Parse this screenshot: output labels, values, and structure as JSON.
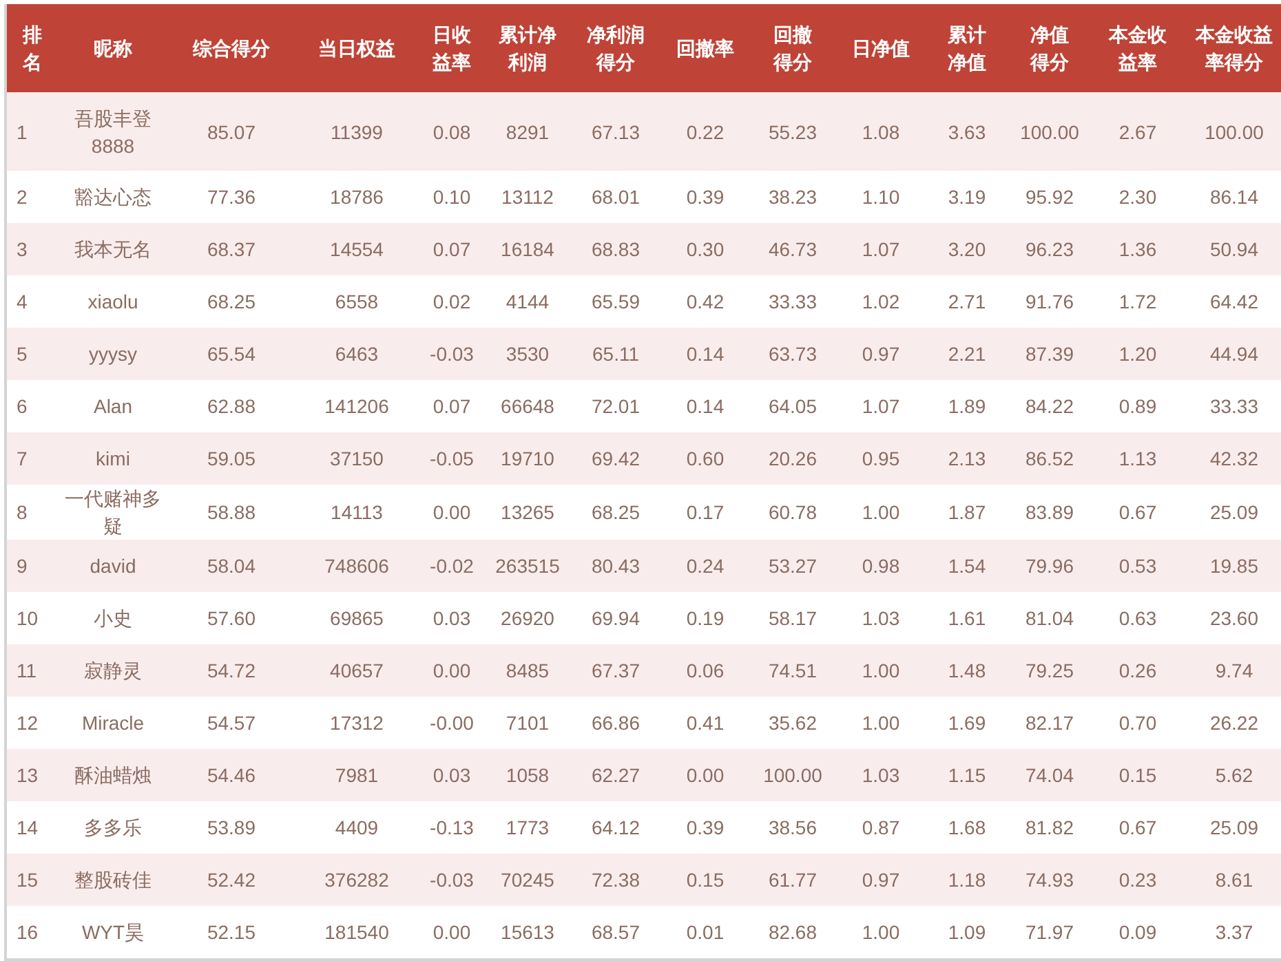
{
  "table": {
    "columns": [
      {
        "lines": [
          "排",
          "名"
        ]
      },
      {
        "lines": [
          "昵称"
        ]
      },
      {
        "lines": [
          "综合得分"
        ]
      },
      {
        "lines": [
          "当日权益"
        ]
      },
      {
        "lines": [
          "日收",
          "益率"
        ]
      },
      {
        "lines": [
          "累计净",
          "利润"
        ]
      },
      {
        "lines": [
          "净利润",
          "得分"
        ]
      },
      {
        "lines": [
          "回撤率"
        ]
      },
      {
        "lines": [
          "回撤",
          "得分"
        ]
      },
      {
        "lines": [
          "日净值"
        ]
      },
      {
        "lines": [
          "累计",
          "净值"
        ]
      },
      {
        "lines": [
          "净值",
          "得分"
        ]
      },
      {
        "lines": [
          "本金收",
          "益率"
        ]
      },
      {
        "lines": [
          "本金收益",
          "率得分"
        ]
      }
    ],
    "rows": [
      [
        "1",
        "吾股丰登8888",
        "85.07",
        "11399",
        "0.08",
        "8291",
        "67.13",
        "0.22",
        "55.23",
        "1.08",
        "3.63",
        "100.00",
        "2.67",
        "100.00"
      ],
      [
        "2",
        "豁达心态",
        "77.36",
        "18786",
        "0.10",
        "13112",
        "68.01",
        "0.39",
        "38.23",
        "1.10",
        "3.19",
        "95.92",
        "2.30",
        "86.14"
      ],
      [
        "3",
        "我本无名",
        "68.37",
        "14554",
        "0.07",
        "16184",
        "68.83",
        "0.30",
        "46.73",
        "1.07",
        "3.20",
        "96.23",
        "1.36",
        "50.94"
      ],
      [
        "4",
        "xiaolu",
        "68.25",
        "6558",
        "0.02",
        "4144",
        "65.59",
        "0.42",
        "33.33",
        "1.02",
        "2.71",
        "91.76",
        "1.72",
        "64.42"
      ],
      [
        "5",
        "yyysy",
        "65.54",
        "6463",
        "-0.03",
        "3530",
        "65.11",
        "0.14",
        "63.73",
        "0.97",
        "2.21",
        "87.39",
        "1.20",
        "44.94"
      ],
      [
        "6",
        "Alan",
        "62.88",
        "141206",
        "0.07",
        "66648",
        "72.01",
        "0.14",
        "64.05",
        "1.07",
        "1.89",
        "84.22",
        "0.89",
        "33.33"
      ],
      [
        "7",
        "kimi",
        "59.05",
        "37150",
        "-0.05",
        "19710",
        "69.42",
        "0.60",
        "20.26",
        "0.95",
        "2.13",
        "86.52",
        "1.13",
        "42.32"
      ],
      [
        "8",
        "一代赌神多疑",
        "58.88",
        "14113",
        "0.00",
        "13265",
        "68.25",
        "0.17",
        "60.78",
        "1.00",
        "1.87",
        "83.89",
        "0.67",
        "25.09"
      ],
      [
        "9",
        "david",
        "58.04",
        "748606",
        "-0.02",
        "263515",
        "80.43",
        "0.24",
        "53.27",
        "0.98",
        "1.54",
        "79.96",
        "0.53",
        "19.85"
      ],
      [
        "10",
        "小史",
        "57.60",
        "69865",
        "0.03",
        "26920",
        "69.94",
        "0.19",
        "58.17",
        "1.03",
        "1.61",
        "81.04",
        "0.63",
        "23.60"
      ],
      [
        "11",
        "寂静灵",
        "54.72",
        "40657",
        "0.00",
        "8485",
        "67.37",
        "0.06",
        "74.51",
        "1.00",
        "1.48",
        "79.25",
        "0.26",
        "9.74"
      ],
      [
        "12",
        "Miracle",
        "54.57",
        "17312",
        "-0.00",
        "7101",
        "66.86",
        "0.41",
        "35.62",
        "1.00",
        "1.69",
        "82.17",
        "0.70",
        "26.22"
      ],
      [
        "13",
        "酥油蜡烛",
        "54.46",
        "7981",
        "0.03",
        "1058",
        "62.27",
        "0.00",
        "100.00",
        "1.03",
        "1.15",
        "74.04",
        "0.15",
        "5.62"
      ],
      [
        "14",
        "多多乐",
        "53.89",
        "4409",
        "-0.13",
        "1773",
        "64.12",
        "0.39",
        "38.56",
        "0.87",
        "1.68",
        "81.82",
        "0.67",
        "25.09"
      ],
      [
        "15",
        "整股砖佳",
        "52.42",
        "376282",
        "-0.03",
        "70245",
        "72.38",
        "0.15",
        "61.77",
        "0.97",
        "1.18",
        "74.93",
        "0.23",
        "8.61"
      ],
      [
        "16",
        "WYT昊",
        "52.15",
        "181540",
        "0.00",
        "15613",
        "68.57",
        "0.01",
        "82.68",
        "1.00",
        "1.09",
        "71.97",
        "0.09",
        "3.37"
      ]
    ]
  }
}
